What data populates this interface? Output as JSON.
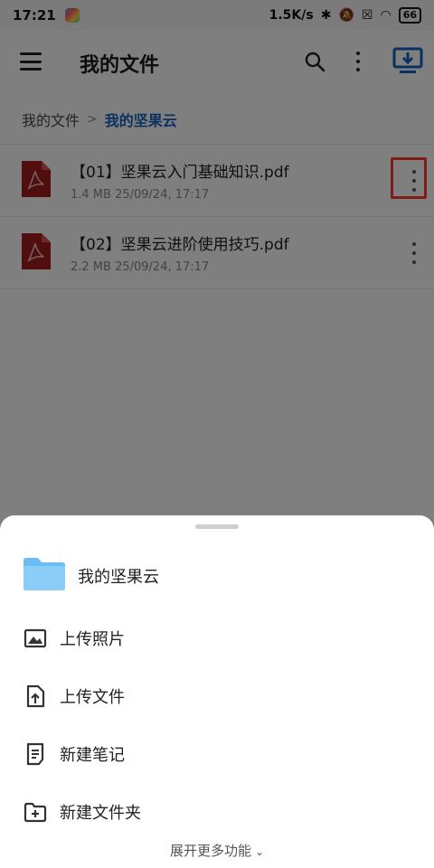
{
  "status_bar": {
    "time": "17:21",
    "speed": "1.5K/s",
    "battery": "66"
  },
  "app_bar": {
    "title": "我的文件"
  },
  "breadcrumb": {
    "root": "我的文件",
    "separator": ">",
    "current": "我的坚果云"
  },
  "files": [
    {
      "name": "【01】坚果云入门基础知识.pdf",
      "meta": "1.4 MB 25/09/24, 17:17"
    },
    {
      "name": "【02】坚果云进阶使用技巧.pdf",
      "meta": "2.2 MB 25/09/24, 17:17"
    }
  ],
  "sheet": {
    "folder_name": "我的坚果云",
    "items": [
      {
        "label": "上传照片",
        "icon": "image-icon"
      },
      {
        "label": "上传文件",
        "icon": "upload-file-icon"
      },
      {
        "label": "新建笔记",
        "icon": "note-icon"
      },
      {
        "label": "新建文件夹",
        "icon": "new-folder-icon"
      }
    ],
    "expand_label": "展开更多功能"
  },
  "colors": {
    "accent": "#1565c0",
    "pdf_red": "#a31d1d",
    "folder_blue": "#6cbcf4",
    "highlight": "#ff3b30"
  }
}
